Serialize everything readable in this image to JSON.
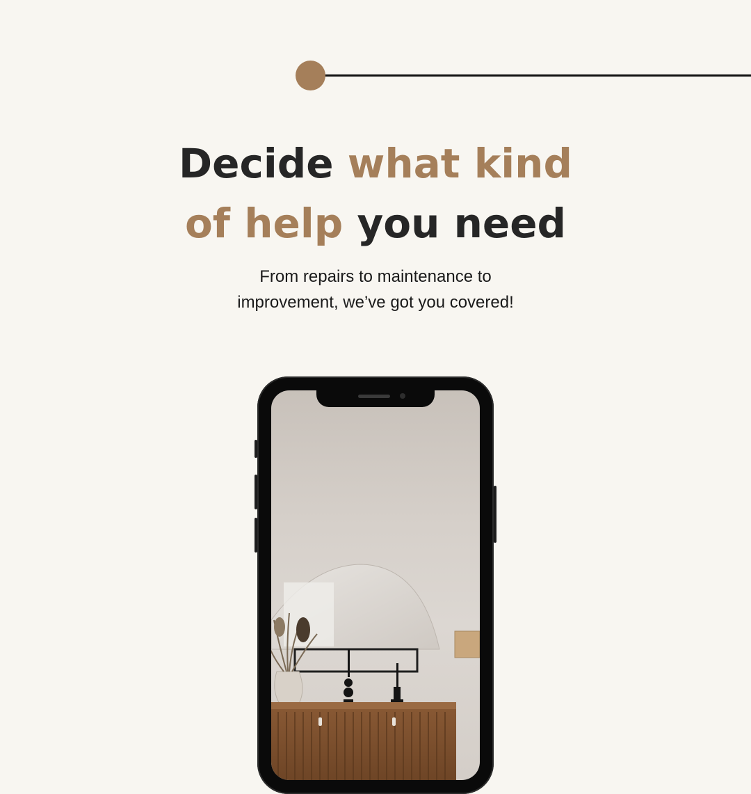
{
  "headline": {
    "part1": "Decide ",
    "part2_accent": "what kind",
    "part3_accent": "of help",
    "part4": " you need"
  },
  "subtext": {
    "line1": "From repairs to maintenance to",
    "line2": "improvement, we’ve got you covered!"
  },
  "colors": {
    "background": "#f8f6f1",
    "accent": "#a57f5a",
    "text": "#262626"
  },
  "phone": {
    "screen_image": "interior-room-photo"
  }
}
